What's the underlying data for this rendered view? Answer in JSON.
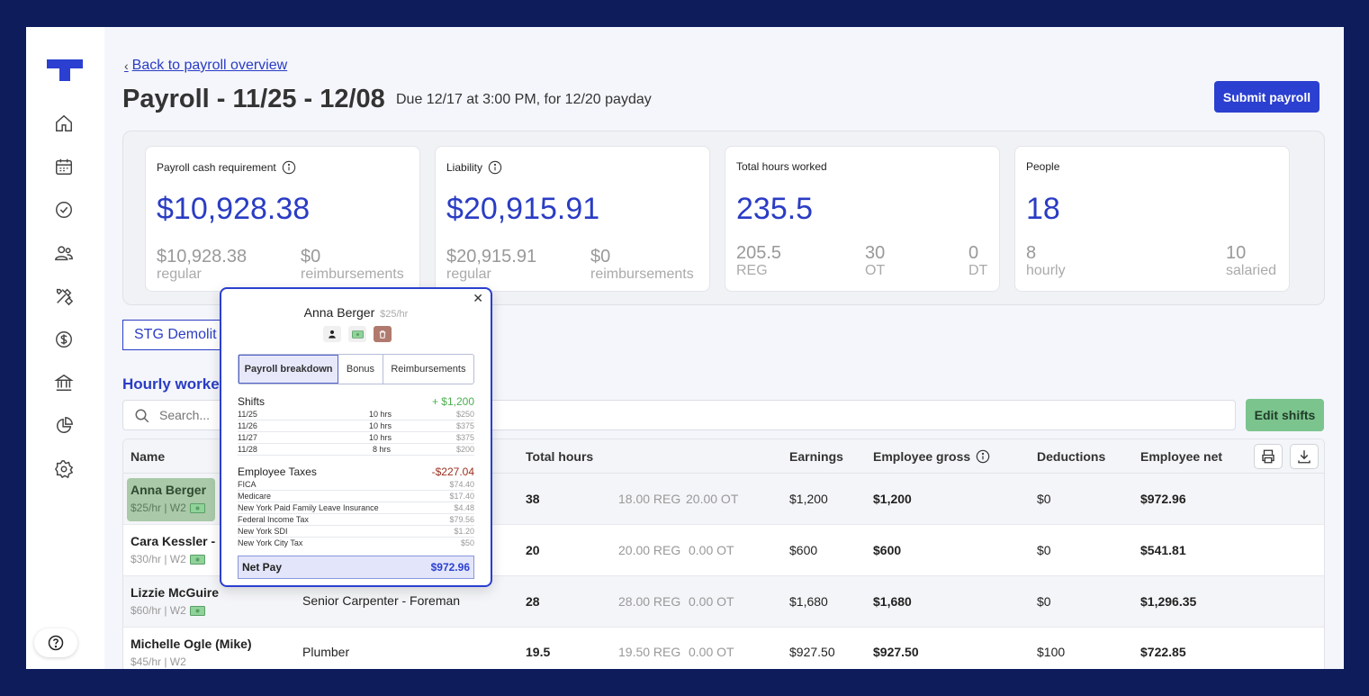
{
  "back_link": "Back to payroll overview",
  "page_title": "Payroll - 11/25 - 12/08",
  "due_text": "Due 12/17 at 3:00 PM, for 12/20 payday",
  "submit_label": "Submit payroll",
  "cards": {
    "cash": {
      "label": "Payroll cash requirement",
      "value": "$10,928.38",
      "sub1_val": "$10,928.38",
      "sub1_lbl": "regular",
      "sub2_val": "$0",
      "sub2_lbl": "reimbursements"
    },
    "liability": {
      "label": "Liability",
      "value": "$20,915.91",
      "sub1_val": "$20,915.91",
      "sub1_lbl": "regular",
      "sub2_val": "$0",
      "sub2_lbl": "reimbursements"
    },
    "hours": {
      "label": "Total hours worked",
      "value": "235.5",
      "sub1_val": "205.5",
      "sub1_lbl": "REG",
      "sub2_val": "30",
      "sub2_lbl": "OT",
      "sub3_val": "0",
      "sub3_lbl": "DT"
    },
    "people": {
      "label": "People",
      "value": "18",
      "sub1_val": "8",
      "sub1_lbl": "hourly",
      "sub2_val": "10",
      "sub2_lbl": "salaried"
    }
  },
  "stg_button": "STG Demolit",
  "hourly_title": "Hourly worker",
  "search_placeholder": "Search...",
  "edit_shifts": "Edit shifts",
  "table": {
    "headers": {
      "name": "Name",
      "total_hours": "Total hours",
      "earnings": "Earnings",
      "employee_gross": "Employee gross",
      "deductions": "Deductions",
      "employee_net": "Employee net"
    },
    "rows": [
      {
        "name": "Anna Berger",
        "sub": "$25/hr | W2",
        "role": "",
        "hours": "38",
        "reg": "18.00 REG",
        "ot": "20.00 OT",
        "earnings": "$1,200",
        "gross": "$1,200",
        "deductions": "$0",
        "net": "$972.96"
      },
      {
        "name": "Cara Kessler -",
        "sub": "$30/hr | W2",
        "role": "",
        "hours": "20",
        "reg": "20.00 REG",
        "ot": "0.00 OT",
        "earnings": "$600",
        "gross": "$600",
        "deductions": "$0",
        "net": "$541.81"
      },
      {
        "name": "Lizzie McGuire",
        "sub": "$60/hr | W2",
        "role": "Senior Carpenter - Foreman",
        "hours": "28",
        "reg": "28.00 REG",
        "ot": "0.00 OT",
        "earnings": "$1,680",
        "gross": "$1,680",
        "deductions": "$0",
        "net": "$1,296.35"
      },
      {
        "name": "Michelle Ogle (Mike)",
        "sub": "$45/hr | W2",
        "role": "Plumber",
        "hours": "19.5",
        "reg": "19.50 REG",
        "ot": "0.00 OT",
        "earnings": "$927.50",
        "gross": "$927.50",
        "deductions": "$100",
        "net": "$722.85"
      }
    ]
  },
  "popover": {
    "name": "Anna Berger",
    "rate": "$25/hr",
    "tabs": [
      "Payroll breakdown",
      "Bonus",
      "Reimbursements"
    ],
    "shifts_label": "Shifts",
    "shifts_total": "+ $1,200",
    "shifts": [
      {
        "date": "11/25",
        "hrs": "10 hrs",
        "amt": "$250"
      },
      {
        "date": "11/26",
        "hrs": "10 hrs",
        "amt": "$375"
      },
      {
        "date": "11/27",
        "hrs": "10 hrs",
        "amt": "$375"
      },
      {
        "date": "11/28",
        "hrs": "8 hrs",
        "amt": "$200"
      }
    ],
    "taxes_label": "Employee Taxes",
    "taxes_total": "-$227.04",
    "taxes": [
      {
        "name": "FICA",
        "amt": "$74.40"
      },
      {
        "name": "Medicare",
        "amt": "$17.40"
      },
      {
        "name": "New York Paid Family Leave Insurance",
        "amt": "$4.48"
      },
      {
        "name": "Federal Income Tax",
        "amt": "$79.56"
      },
      {
        "name": "New York SDI",
        "amt": "$1.20"
      },
      {
        "name": "New York City Tax",
        "amt": "$50"
      }
    ],
    "net_label": "Net Pay",
    "net_value": "$972.96"
  },
  "colors": {
    "brand": "#2b3fd0",
    "accent_green": "#7cc48e",
    "tax_red": "#9b2f1e",
    "gain_green": "#4caf50"
  }
}
